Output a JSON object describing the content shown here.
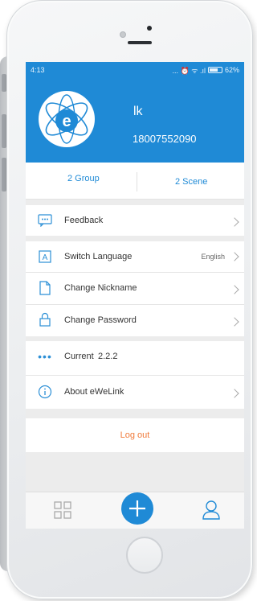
{
  "status_bar": {
    "time": "4:13",
    "indicators": "... ⏰ ᯤ .ıl",
    "battery": "62%"
  },
  "profile": {
    "name": "lk",
    "phone": "18007552090",
    "avatar_icon": "ewelink-logo-icon"
  },
  "counts": {
    "groups": "2 Group",
    "scenes": "2 Scene"
  },
  "menu": {
    "feedback": {
      "label": "Feedback",
      "icon": "chat-icon"
    },
    "switch_language": {
      "label": "Switch Language",
      "value": "English",
      "icon": "language-icon"
    },
    "change_nickname": {
      "label": "Change Nickname",
      "icon": "edit-icon"
    },
    "change_password": {
      "label": "Change Password",
      "icon": "lock-icon"
    },
    "current_version": {
      "label": "Current",
      "value": "2.2.2",
      "icon": "more-dots-icon"
    },
    "about": {
      "label": "About eWeLink",
      "icon": "info-icon"
    }
  },
  "logout": {
    "label": "Log out"
  },
  "tabs": {
    "devices": "grid-icon",
    "add": "plus-icon",
    "profile": "user-icon"
  },
  "colors": {
    "primary": "#1f8ad6",
    "logout": "#f07a3a",
    "background": "#ececec"
  }
}
